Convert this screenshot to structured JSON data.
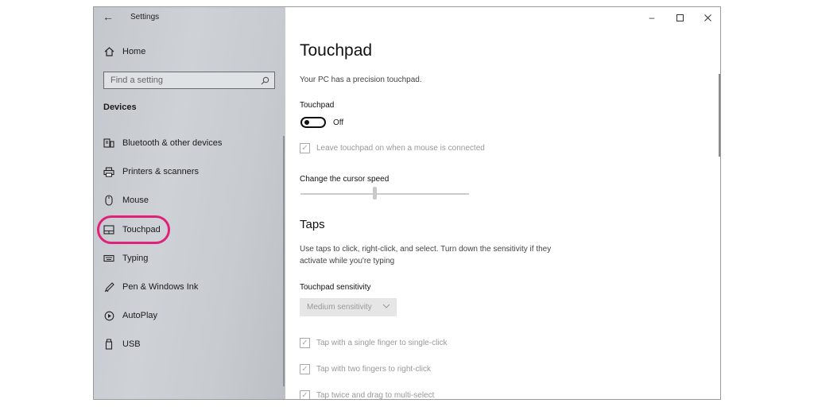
{
  "window": {
    "title": "Settings"
  },
  "sidebar": {
    "home_label": "Home",
    "search_placeholder": "Find a setting",
    "section_label": "Devices",
    "items": [
      {
        "label": "Bluetooth & other devices",
        "icon": "bluetooth-devices-icon"
      },
      {
        "label": "Printers & scanners",
        "icon": "printer-icon"
      },
      {
        "label": "Mouse",
        "icon": "mouse-icon"
      },
      {
        "label": "Touchpad",
        "icon": "touchpad-icon",
        "selected": true
      },
      {
        "label": "Typing",
        "icon": "keyboard-icon"
      },
      {
        "label": "Pen & Windows Ink",
        "icon": "pen-icon"
      },
      {
        "label": "AutoPlay",
        "icon": "autoplay-icon"
      },
      {
        "label": "USB",
        "icon": "usb-icon"
      }
    ],
    "highlight_color": "#e0217a"
  },
  "main": {
    "title": "Touchpad",
    "precision_note": "Your PC has a precision touchpad.",
    "touchpad_label": "Touchpad",
    "toggle_state": "Off",
    "leave_on_checkbox": "Leave touchpad on when a mouse is connected",
    "cursor_speed_label": "Change the cursor speed",
    "taps_heading": "Taps",
    "taps_description_line1": "Use taps to click, right-click, and select. Turn down the sensitivity if they",
    "taps_description_line2": "activate while you're typing",
    "sensitivity_label": "Touchpad sensitivity",
    "sensitivity_value": "Medium sensitivity",
    "tap_options": [
      "Tap with a single finger to single-click",
      "Tap with two fingers to right-click",
      "Tap twice and drag to multi-select"
    ]
  }
}
